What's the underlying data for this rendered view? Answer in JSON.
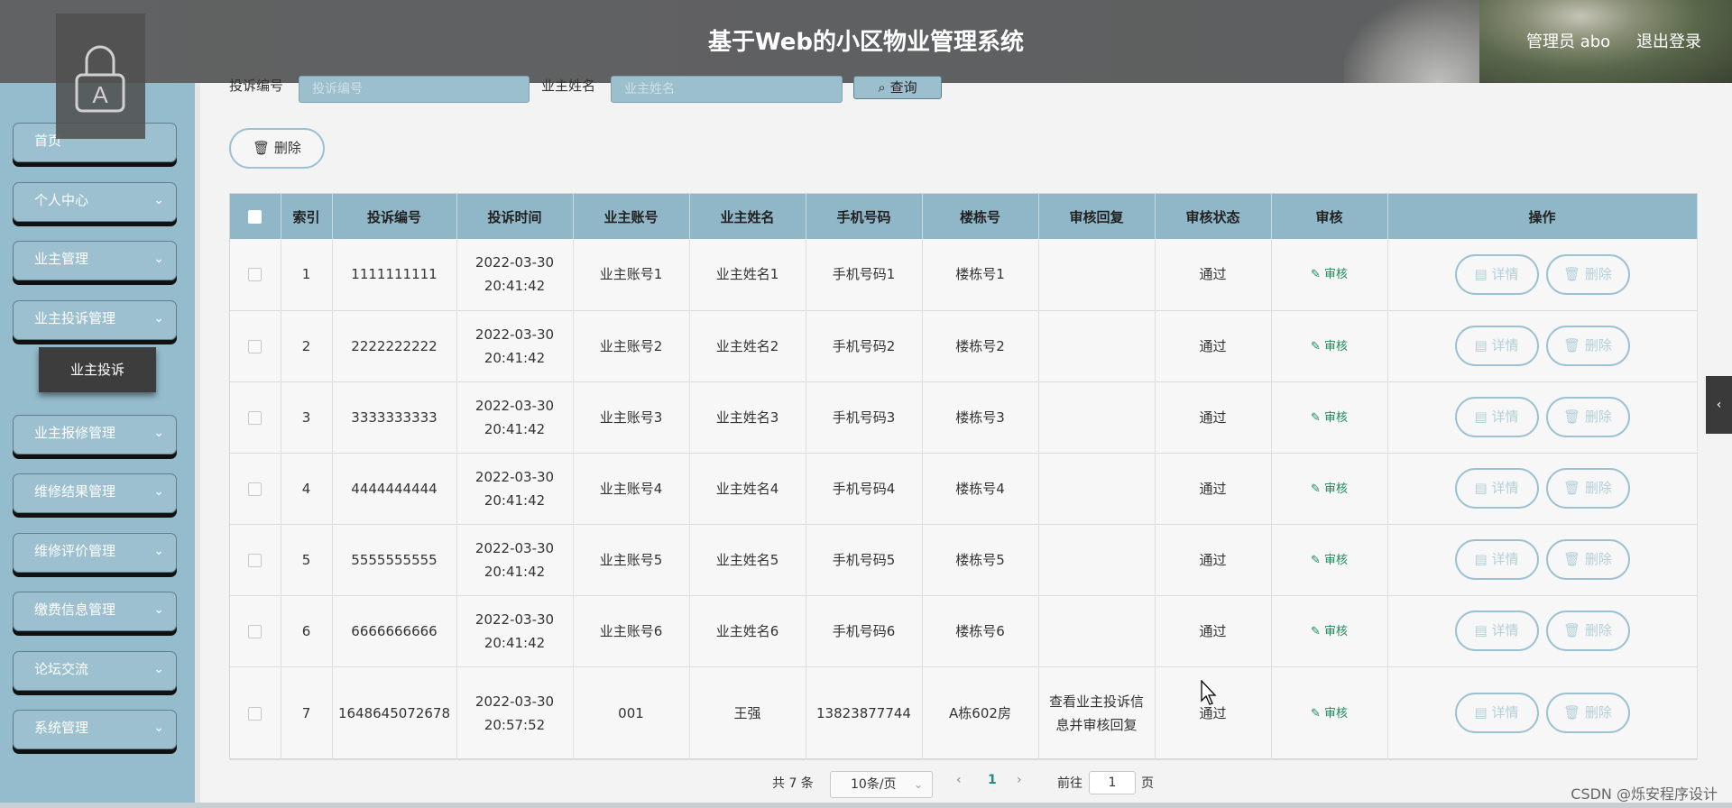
{
  "header": {
    "title": "基于Web的小区物业管理系统",
    "admin": "管理员 abo",
    "logout": "退出登录"
  },
  "sidebar": {
    "items": [
      {
        "label": "首页"
      },
      {
        "label": "个人中心"
      },
      {
        "label": "业主管理"
      },
      {
        "label": "业主投诉管理"
      },
      {
        "label": "业主报修管理"
      },
      {
        "label": "维修结果管理"
      },
      {
        "label": "维修评价管理"
      },
      {
        "label": "缴费信息管理"
      },
      {
        "label": "论坛交流"
      },
      {
        "label": "系统管理"
      }
    ],
    "active_sub": "业主投诉"
  },
  "search": {
    "complaint_label": "投诉编号",
    "complaint_placeholder": "投诉编号",
    "owner_label": "业主姓名",
    "owner_placeholder": "业主姓名",
    "button": "查询"
  },
  "toolbar": {
    "delete_label": "删除"
  },
  "table": {
    "columns": [
      "索引",
      "投诉编号",
      "投诉时间",
      "业主账号",
      "业主姓名",
      "手机号码",
      "楼栋号",
      "审核回复",
      "审核状态",
      "审核",
      "操作"
    ],
    "audit_action": "审核",
    "detail_label": "详情",
    "delete_label": "删除",
    "rows": [
      {
        "index": "1",
        "code": "1111111111",
        "time": "2022-03-30 20:41:42",
        "account": "业主账号1",
        "name": "业主姓名1",
        "phone": "手机号码1",
        "building": "楼栋号1",
        "reply": "",
        "status": "通过"
      },
      {
        "index": "2",
        "code": "2222222222",
        "time": "2022-03-30 20:41:42",
        "account": "业主账号2",
        "name": "业主姓名2",
        "phone": "手机号码2",
        "building": "楼栋号2",
        "reply": "",
        "status": "通过"
      },
      {
        "index": "3",
        "code": "3333333333",
        "time": "2022-03-30 20:41:42",
        "account": "业主账号3",
        "name": "业主姓名3",
        "phone": "手机号码3",
        "building": "楼栋号3",
        "reply": "",
        "status": "通过"
      },
      {
        "index": "4",
        "code": "4444444444",
        "time": "2022-03-30 20:41:42",
        "account": "业主账号4",
        "name": "业主姓名4",
        "phone": "手机号码4",
        "building": "楼栋号4",
        "reply": "",
        "status": "通过"
      },
      {
        "index": "5",
        "code": "5555555555",
        "time": "2022-03-30 20:41:42",
        "account": "业主账号5",
        "name": "业主姓名5",
        "phone": "手机号码5",
        "building": "楼栋号5",
        "reply": "",
        "status": "通过"
      },
      {
        "index": "6",
        "code": "6666666666",
        "time": "2022-03-30 20:41:42",
        "account": "业主账号6",
        "name": "业主姓名6",
        "phone": "手机号码6",
        "building": "楼栋号6",
        "reply": "",
        "status": "通过"
      },
      {
        "index": "7",
        "code": "1648645072678",
        "time": "2022-03-30 20:57:52",
        "account": "001",
        "name": "王强",
        "phone": "13823877744",
        "building": "A栋602房",
        "reply": "查看业主投诉信息并审核回复",
        "status": "通过"
      }
    ]
  },
  "pagination": {
    "total": "共 7 条",
    "page_size": "10条/页",
    "current_page": "1",
    "goto_label": "前往",
    "goto_value": "1",
    "page_suffix": "页"
  },
  "watermark": "CSDN @烁安程序设计",
  "colors": {
    "sidebar": "#94bccc",
    "table_header": "#90b7c8",
    "accent_green": "#1e8a5a"
  }
}
